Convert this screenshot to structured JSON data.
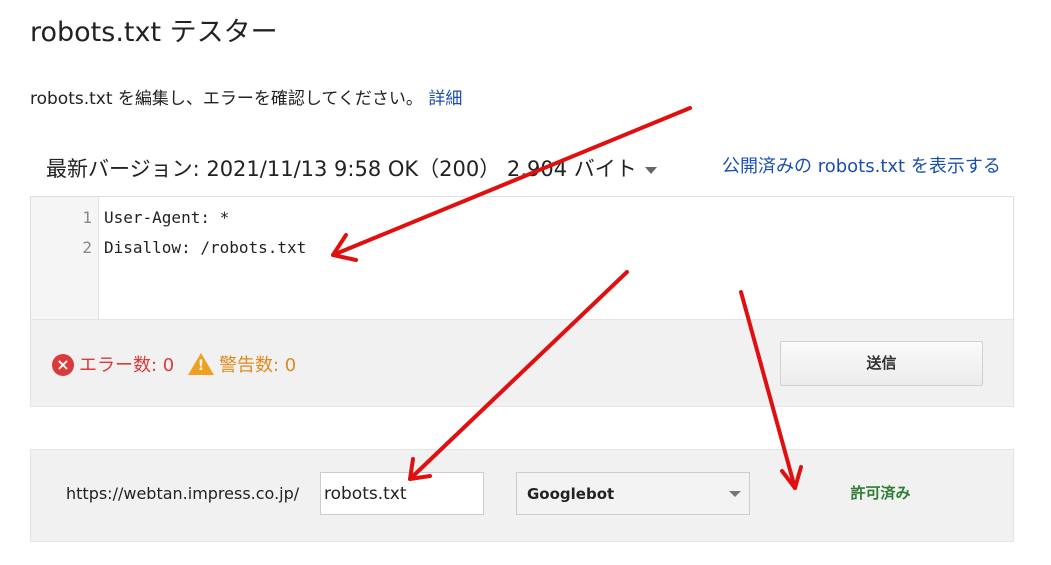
{
  "page": {
    "title": "robots.txt テスター",
    "description": "robots.txt を編集し、エラーを確認してください。",
    "details_link": "詳細"
  },
  "version": {
    "label": "最新バージョン: 2021/11/13 9:58 OK（200） 2,904 バイト",
    "view_live_link": "公開済みの robots.txt を表示する"
  },
  "editor": {
    "lines": [
      {
        "num": "1",
        "text": "User-Agent: *"
      },
      {
        "num": "2",
        "text": "Disallow: /robots.txt"
      }
    ]
  },
  "status": {
    "errors_label": "エラー数: 0",
    "warnings_label": "警告数: 0",
    "error_color": "#d93a3a",
    "warning_color": "#e08a1e",
    "submit_label": "送信"
  },
  "test": {
    "base_url": "https://webtan.impress.co.jp/",
    "path_value": "robots.txt",
    "user_agent_selected": "Googlebot",
    "result_label": "許可済み",
    "result_color": "#2e7d32"
  },
  "annotation": {
    "arrow_color": "#e01010"
  }
}
